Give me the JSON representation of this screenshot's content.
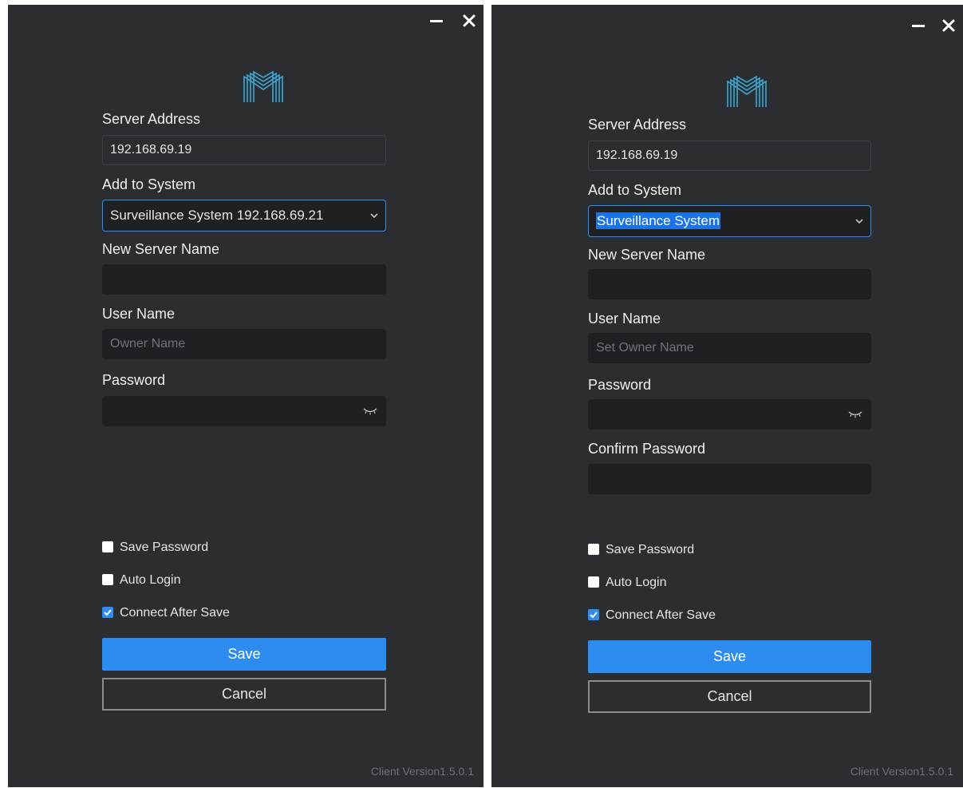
{
  "left_dialog": {
    "server_address_label": "Server Address",
    "server_address_value": "192.168.69.19",
    "add_to_system_label": "Add to System",
    "add_to_system_value": "Surveillance System 192.168.69.21",
    "new_server_name_label": "New Server Name",
    "new_server_name_value": "",
    "user_name_label": "User Name",
    "user_name_placeholder": "Owner Name",
    "password_label": "Password",
    "save_password_label": "Save Password",
    "save_password_checked": false,
    "auto_login_label": "Auto Login",
    "auto_login_checked": false,
    "connect_after_save_label": "Connect After Save",
    "connect_after_save_checked": true,
    "save_label": "Save",
    "cancel_label": "Cancel",
    "version": "Client Version1.5.0.1"
  },
  "right_dialog": {
    "server_address_label": "Server Address",
    "server_address_value": "192.168.69.19",
    "add_to_system_label": "Add to System",
    "add_to_system_value": "Surveillance System",
    "new_server_name_label": "New Server Name",
    "new_server_name_value": "",
    "user_name_label": "User Name",
    "user_name_placeholder": "Set Owner Name",
    "password_label": "Password",
    "confirm_password_label": "Confirm Password",
    "save_password_label": "Save Password",
    "save_password_checked": false,
    "auto_login_label": "Auto Login",
    "auto_login_checked": false,
    "connect_after_save_label": "Connect After Save",
    "connect_after_save_checked": true,
    "save_label": "Save",
    "cancel_label": "Cancel",
    "version": "Client Version1.5.0.1"
  },
  "icons": {
    "minimize": "minimize-icon",
    "close": "close-icon",
    "logo": "m-logo-icon",
    "dropdown": "chevron-down-icon",
    "password_visibility": "eye-closed-icon",
    "checkbox_checked": "checkmark-icon"
  },
  "colors": {
    "panel_bg": "#2b2d31",
    "input_bg": "#1f2023",
    "accent": "#2d8cf0",
    "logo": "#3ba9d6"
  }
}
